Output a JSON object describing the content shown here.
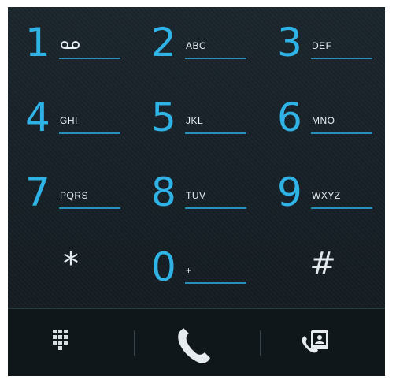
{
  "keypad": {
    "keys": [
      {
        "digit": "1",
        "letters": "ꝏ",
        "letters_note": "voicemail-symbol"
      },
      {
        "digit": "2",
        "letters": "ABC"
      },
      {
        "digit": "3",
        "letters": "DEF"
      },
      {
        "digit": "4",
        "letters": "GHI"
      },
      {
        "digit": "5",
        "letters": "JKL"
      },
      {
        "digit": "6",
        "letters": "MNO"
      },
      {
        "digit": "7",
        "letters": "PQRS"
      },
      {
        "digit": "8",
        "letters": "TUV"
      },
      {
        "digit": "9",
        "letters": "WXYZ"
      },
      {
        "symbol": "*"
      },
      {
        "digit": "0",
        "letters": "+"
      },
      {
        "symbol": "#"
      }
    ]
  },
  "toolbar": {
    "items": [
      {
        "icon": "dialpad-icon"
      },
      {
        "icon": "phone-icon"
      },
      {
        "icon": "contacts-icon"
      }
    ]
  },
  "colors": {
    "accent": "#2fb2e6",
    "underline": "#2a8fbc",
    "background": "#121a1f",
    "text": "#e8eef2"
  }
}
